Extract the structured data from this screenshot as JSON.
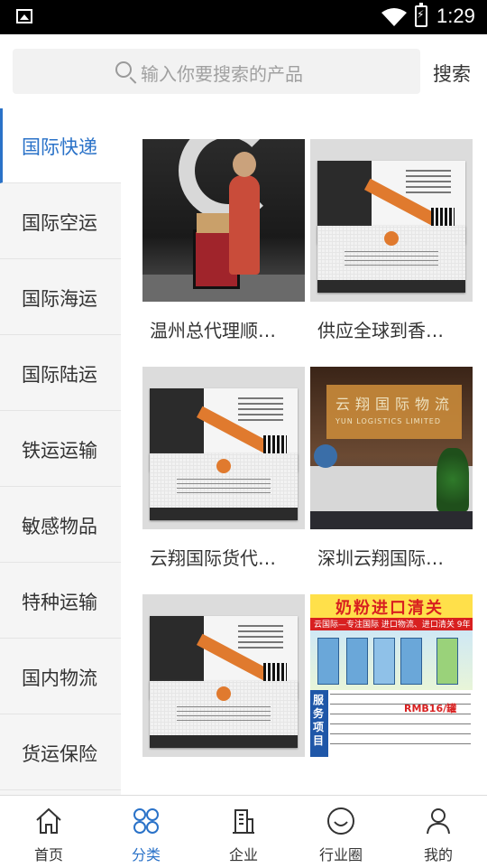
{
  "status_bar": {
    "time": "1:29"
  },
  "search": {
    "placeholder": "输入你要搜索的产品",
    "button_label": "搜索"
  },
  "sidebar": {
    "items": [
      {
        "label": "国际快递",
        "active": true
      },
      {
        "label": "国际空运",
        "active": false
      },
      {
        "label": "国际海运",
        "active": false
      },
      {
        "label": "国际陆运",
        "active": false
      },
      {
        "label": "铁运运输",
        "active": false
      },
      {
        "label": "敏感物品",
        "active": false
      },
      {
        "label": "特种运输",
        "active": false
      },
      {
        "label": "国内物流",
        "active": false
      },
      {
        "label": "货运保险",
        "active": false
      }
    ]
  },
  "products": [
    {
      "title": "温州总代理顺…",
      "image": "courier-photo"
    },
    {
      "title": "供应全球到香…",
      "image": "business-card"
    },
    {
      "title": "云翔国际货代…",
      "image": "business-card"
    },
    {
      "title": "深圳云翔国际…",
      "image": "office-photo"
    },
    {
      "title": "",
      "image": "business-card"
    },
    {
      "title": "",
      "image": "milk-powder-ad"
    }
  ],
  "images": {
    "office_sign_main": "云翔国际物流",
    "office_sign_sub": "YUN LOGISTICS LIMITED",
    "milk_ad_title": "奶粉进口清关",
    "milk_ad_subtitle": "云国际—专注国际 进口物流、进口清关 9年",
    "milk_ad_side": "服务项目",
    "milk_ad_price": "RMB16/罐"
  },
  "tabbar": {
    "tabs": [
      {
        "label": "首页",
        "icon": "home-icon",
        "active": false
      },
      {
        "label": "分类",
        "icon": "category-icon",
        "active": true
      },
      {
        "label": "企业",
        "icon": "building-icon",
        "active": false
      },
      {
        "label": "行业圈",
        "icon": "smile-icon",
        "active": false
      },
      {
        "label": "我的",
        "icon": "user-icon",
        "active": false
      }
    ]
  },
  "colors": {
    "accent": "#2a72c8",
    "sidebar_bg": "#f5f5f5",
    "status_bar_bg": "#000000"
  }
}
